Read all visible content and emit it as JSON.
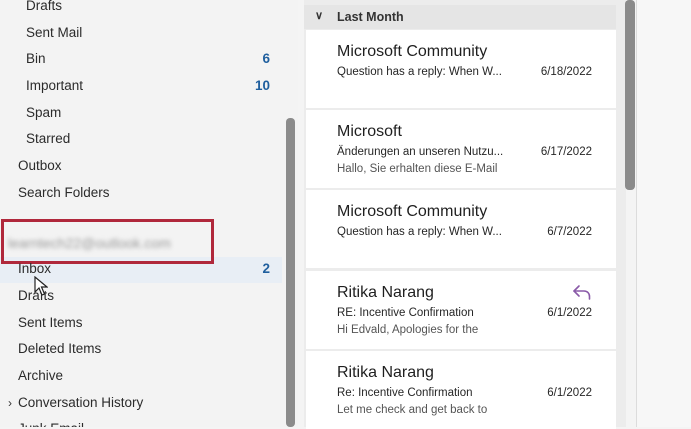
{
  "folders": {
    "items": [
      {
        "label": "Drafts",
        "count": ""
      },
      {
        "label": "Sent Mail",
        "count": ""
      },
      {
        "label": "Bin",
        "count": "6"
      },
      {
        "label": "Important",
        "count": "10"
      },
      {
        "label": "Spam",
        "count": ""
      },
      {
        "label": "Starred",
        "count": ""
      },
      {
        "label": "Outbox",
        "count": ""
      },
      {
        "label": "Search Folders",
        "count": ""
      }
    ],
    "account_email": "learntech22@outlook.com",
    "account_items": [
      {
        "label": "Inbox",
        "count": "2"
      },
      {
        "label": "Drafts",
        "count": ""
      },
      {
        "label": "Sent Items",
        "count": ""
      },
      {
        "label": "Deleted Items",
        "count": ""
      },
      {
        "label": "Archive",
        "count": ""
      },
      {
        "label": "Conversation History",
        "count": ""
      },
      {
        "label": "Junk Email",
        "count": ""
      }
    ]
  },
  "message_list": {
    "group_title": "Last Month",
    "messages": [
      {
        "sender": "Microsoft Community",
        "subject": "Question has a reply: When  W...",
        "preview": "",
        "date": "6/18/2022",
        "replied": false
      },
      {
        "sender": "Microsoft",
        "subject": "Änderungen an unseren Nutzu...",
        "preview": "Hallo, Sie erhalten diese E-Mail",
        "date": "6/17/2022",
        "replied": false
      },
      {
        "sender": "Microsoft Community",
        "subject": "Question has a reply: When  W...",
        "preview": "",
        "date": "6/7/2022",
        "replied": false
      },
      {
        "sender": "Ritika Narang",
        "subject": "RE: Incentive Confirmation",
        "preview": "Hi Edvald,   Apologies for the",
        "date": "6/1/2022",
        "replied": true
      },
      {
        "sender": "Ritika Narang",
        "subject": "Re: Incentive Confirmation",
        "preview": "Let me check and get back to",
        "date": "6/1/2022",
        "replied": false
      }
    ]
  },
  "colors": {
    "accent": "#1f5f9e",
    "highlight_box": "#b0283b",
    "reply_icon": "#8a5aa8"
  }
}
